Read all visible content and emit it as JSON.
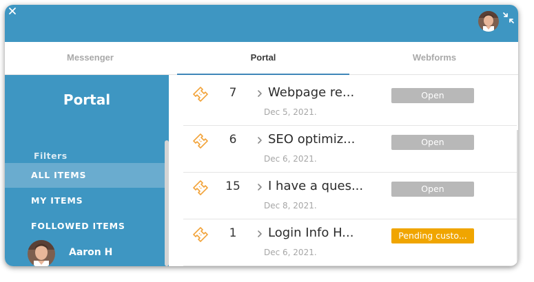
{
  "header": {
    "close_icon": "close-icon",
    "avatar_icon": "user-avatar",
    "collapse_icon": "collapse-arrows-icon",
    "background_color": "#3e96c2"
  },
  "tabs": [
    {
      "label": "Messenger",
      "active": false
    },
    {
      "label": "Portal",
      "active": true
    },
    {
      "label": "Webforms",
      "active": false
    }
  ],
  "sidebar": {
    "title": "Portal",
    "filters_label": "Filters",
    "filters": [
      {
        "label": "ALL ITEMS",
        "active": true
      },
      {
        "label": "MY ITEMS",
        "active": false
      },
      {
        "label": "FOLLOWED ITEMS",
        "active": false
      }
    ],
    "user": {
      "name": "Aaron H"
    }
  },
  "tickets": [
    {
      "icon": "ticket-icon",
      "number": "7",
      "title": "Webpage re...",
      "date": "Dec 5, 2021.",
      "status": "Open",
      "status_color": "#b8b8b8"
    },
    {
      "icon": "ticket-icon",
      "number": "6",
      "title": "SEO optimiz...",
      "date": "Dec 6, 2021.",
      "status": "Open",
      "status_color": "#b8b8b8"
    },
    {
      "icon": "ticket-icon",
      "number": "15",
      "title": "I have a ques...",
      "date": "Dec 8, 2021.",
      "status": "Open",
      "status_color": "#b8b8b8"
    },
    {
      "icon": "ticket-icon",
      "number": "1",
      "title": "Login Info H...",
      "date": "Dec 6, 2021.",
      "status": "Pending custo...",
      "status_color": "#f0a500"
    }
  ],
  "colors": {
    "accent": "#3e96c2",
    "ticket_icon": "#f2a33a",
    "pending": "#f0a500",
    "open": "#b8b8b8"
  }
}
